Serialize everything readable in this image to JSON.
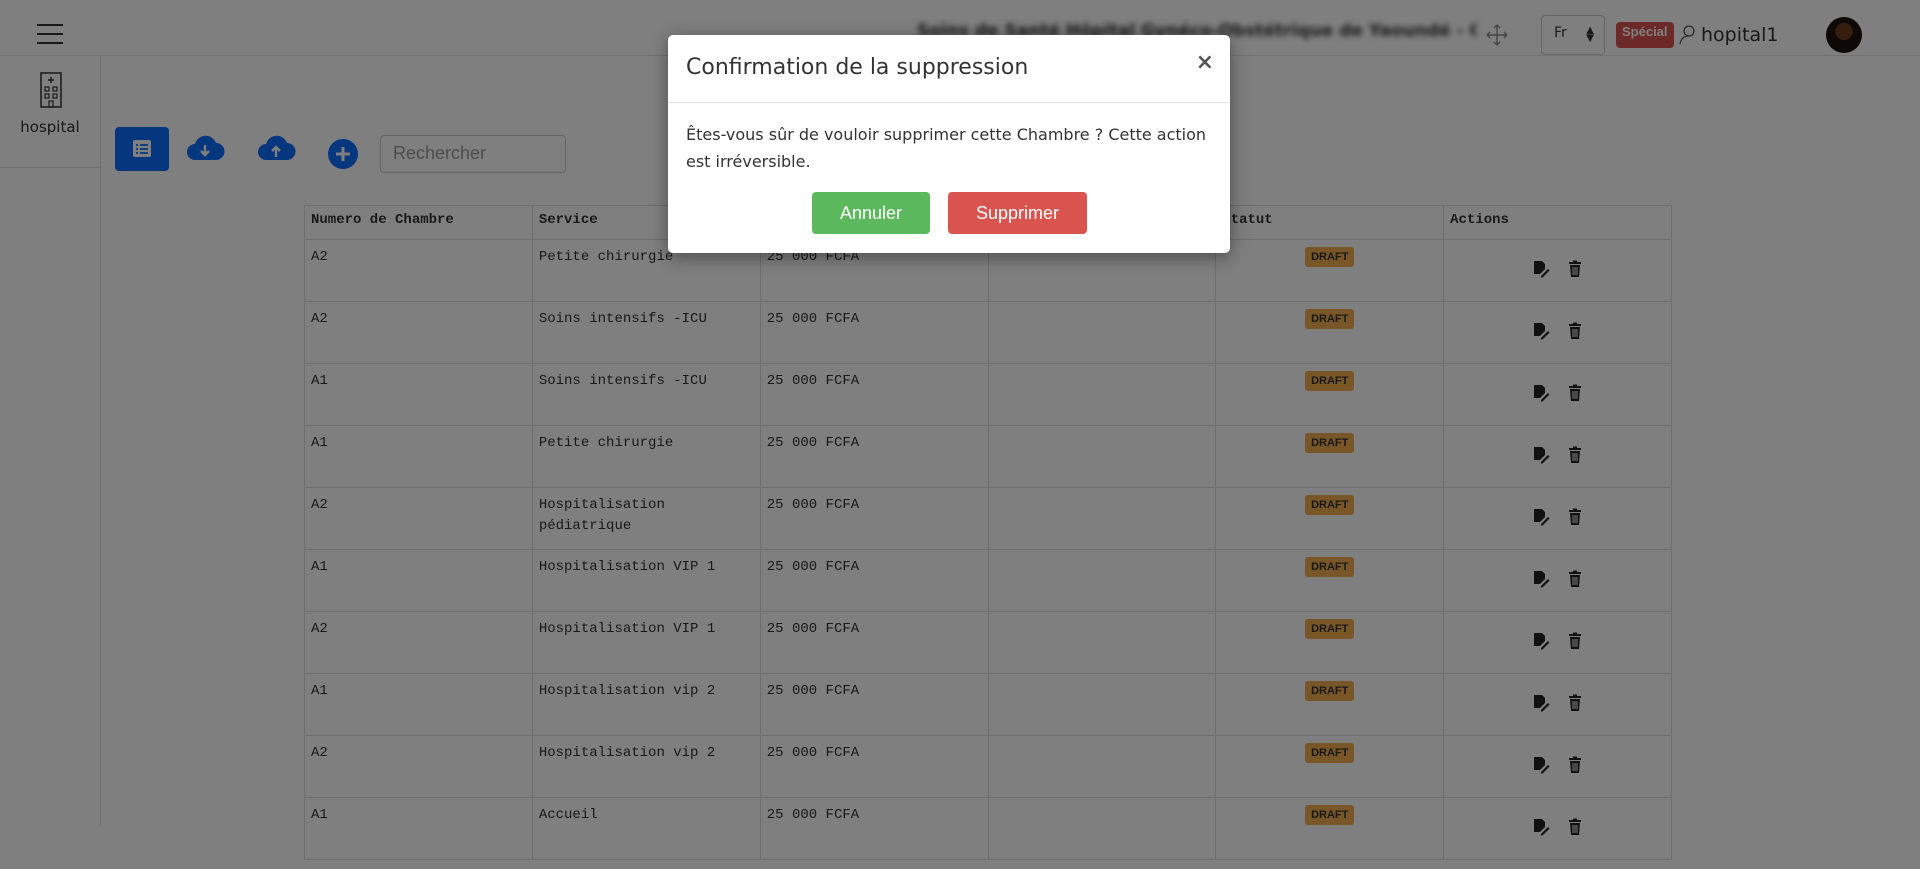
{
  "header": {
    "hospital_name": "Soins de Santé Hôpital Gynéco-Obstétrique de Yaoundé - CHRY",
    "language": "Fr",
    "special_badge": "Spécial",
    "username": "hopital1"
  },
  "sidebar": {
    "items": [
      {
        "label": "hospital",
        "icon": "hospital-building-icon"
      }
    ]
  },
  "toolbar": {
    "search_placeholder": "Rechercher",
    "icons": [
      "list-icon",
      "cloud-download-icon",
      "cloud-upload-icon",
      "plus-circle-icon"
    ]
  },
  "table": {
    "headers": [
      "Numero de Chambre",
      "Service",
      "",
      "",
      "Statut",
      "Actions"
    ],
    "rows": [
      {
        "number": "A2",
        "service": "Petite chirurgie",
        "price": "25 000 FCFA",
        "extra": "",
        "status": "DRAFT"
      },
      {
        "number": "A2",
        "service": "Soins intensifs -ICU",
        "price": "25 000 FCFA",
        "extra": "",
        "status": "DRAFT"
      },
      {
        "number": "A1",
        "service": "Soins intensifs -ICU",
        "price": "25 000 FCFA",
        "extra": "",
        "status": "DRAFT"
      },
      {
        "number": "A1",
        "service": "Petite chirurgie",
        "price": "25 000 FCFA",
        "extra": "",
        "status": "DRAFT"
      },
      {
        "number": "A2",
        "service": "Hospitalisation pédiatrique",
        "price": "25 000 FCFA",
        "extra": "",
        "status": "DRAFT"
      },
      {
        "number": "A1",
        "service": "Hospitalisation VIP 1",
        "price": "25 000 FCFA",
        "extra": "",
        "status": "DRAFT"
      },
      {
        "number": "A2",
        "service": "Hospitalisation VIP 1",
        "price": "25 000 FCFA",
        "extra": "",
        "status": "DRAFT"
      },
      {
        "number": "A1",
        "service": "Hospitalisation vip 2",
        "price": "25 000 FCFA",
        "extra": "",
        "status": "DRAFT"
      },
      {
        "number": "A2",
        "service": "Hospitalisation vip 2",
        "price": "25 000 FCFA",
        "extra": "",
        "status": "DRAFT"
      },
      {
        "number": "A1",
        "service": "Accueil",
        "price": "25 000 FCFA",
        "extra": "",
        "status": "DRAFT"
      }
    ]
  },
  "modal": {
    "title": "Confirmation de la suppression",
    "close": "×",
    "message": "Êtes-vous sûr de vouloir supprimer cette Chambre ? Cette action est irréversible.",
    "cancel_label": "Annuler",
    "delete_label": "Supprimer"
  },
  "colors": {
    "primary": "#0d6efd",
    "draft": "#f0ad4e",
    "cancel": "#5cb85c",
    "danger": "#d9534f",
    "overlay": "rgba(0,0,0,0.5)"
  }
}
